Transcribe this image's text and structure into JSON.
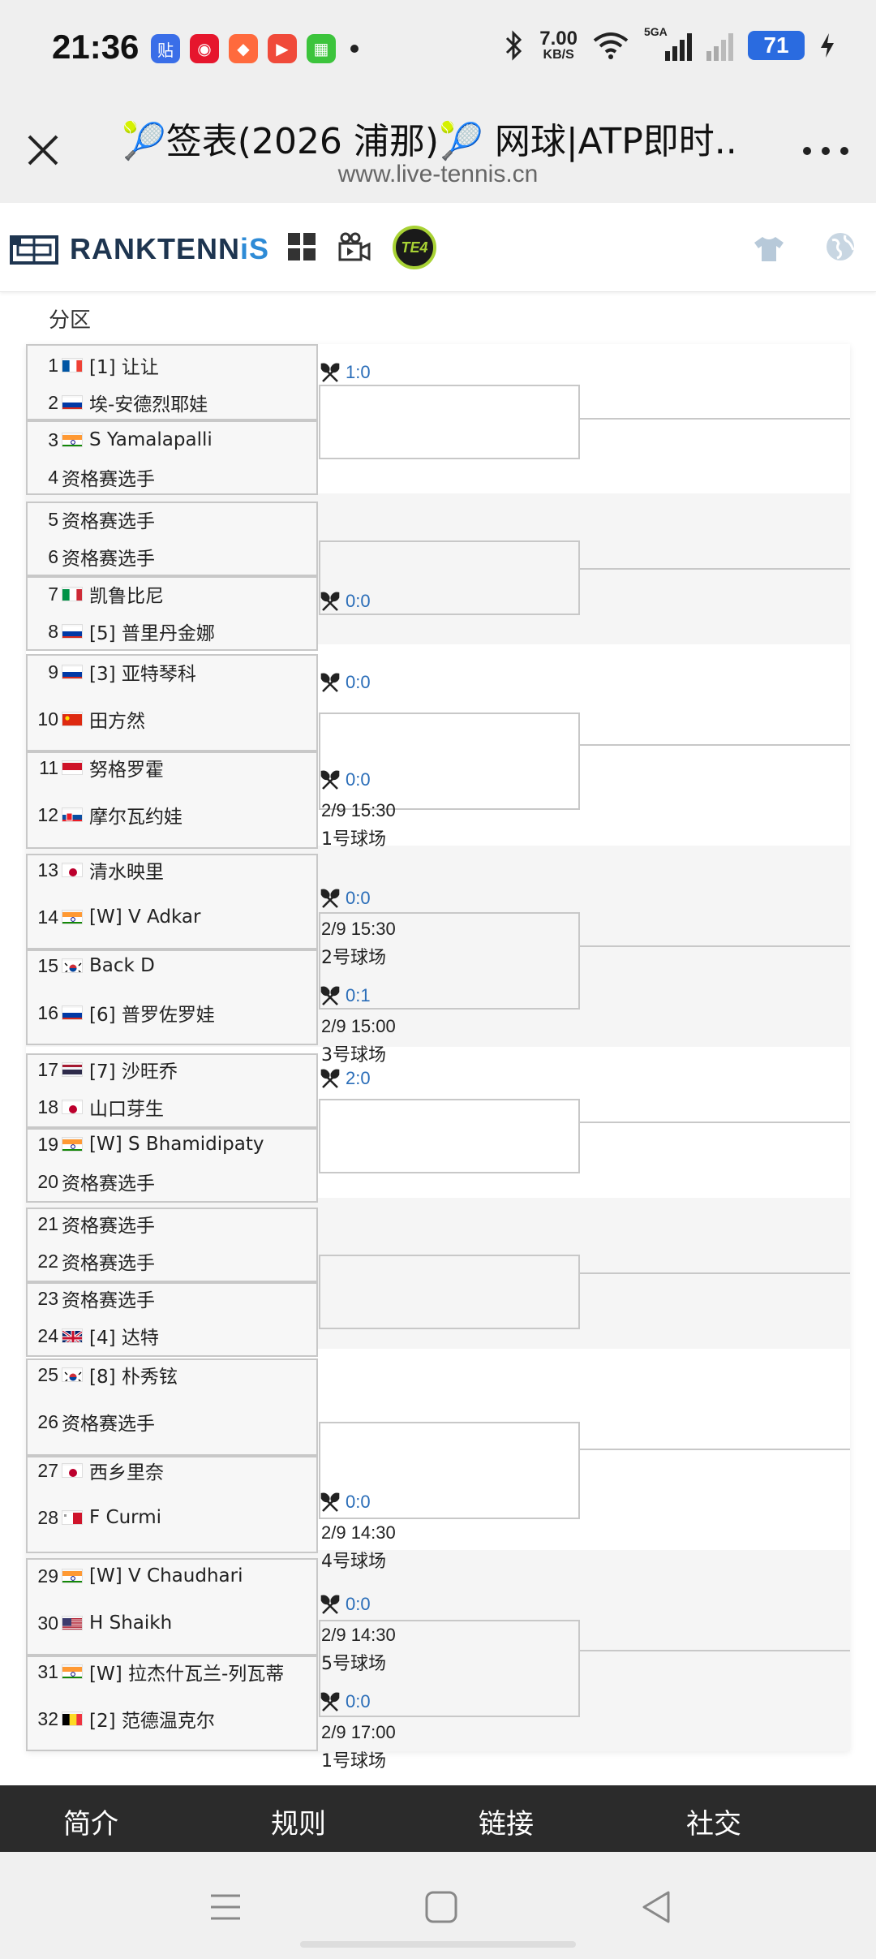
{
  "status_bar": {
    "time": "21:36",
    "net_speed_value": "7.00",
    "net_speed_unit": "KB/S",
    "signal_label": "5GA",
    "battery": "71",
    "app_icons": [
      {
        "name": "tieba-icon",
        "glyph": "贴",
        "color": "#3a6ee8"
      },
      {
        "name": "weibo-icon",
        "glyph": "◉",
        "color": "#e6162d"
      },
      {
        "name": "game-icon",
        "glyph": "◆",
        "color": "#ff6a3d"
      },
      {
        "name": "video-play-icon",
        "glyph": "▶",
        "color": "#f04a3a"
      },
      {
        "name": "app-store-icon",
        "glyph": "▦",
        "color": "#3cc43c"
      }
    ]
  },
  "browser": {
    "title": "🎾签表(2026 浦那)🎾 网球|ATP即时...",
    "url": "www.live-tennis.cn"
  },
  "site_header": {
    "logo_text_main": "RANKTENN",
    "logo_text_accent": "iS",
    "badge": "TE4"
  },
  "section": {
    "title": "分区"
  },
  "players": [
    {
      "seed": "1",
      "flag": "fr",
      "name": "[1] 让让"
    },
    {
      "seed": "2",
      "flag": "ru",
      "name": "埃-安德烈耶娃"
    },
    {
      "seed": "3",
      "flag": "in",
      "name": "S Yamalapalli"
    },
    {
      "seed": "4",
      "flag": "",
      "name": "资格赛选手"
    },
    {
      "seed": "5",
      "flag": "",
      "name": "资格赛选手"
    },
    {
      "seed": "6",
      "flag": "",
      "name": "资格赛选手"
    },
    {
      "seed": "7",
      "flag": "it",
      "name": "凯鲁比尼"
    },
    {
      "seed": "8",
      "flag": "ru",
      "name": "[5] 普里丹金娜"
    },
    {
      "seed": "9",
      "flag": "ru",
      "name": "[3] 亚特琴科"
    },
    {
      "seed": "10",
      "flag": "cn",
      "name": "田方然"
    },
    {
      "seed": "11",
      "flag": "id",
      "name": "努格罗霍"
    },
    {
      "seed": "12",
      "flag": "sk",
      "name": "摩尔瓦约娃"
    },
    {
      "seed": "13",
      "flag": "jp",
      "name": "清水映里"
    },
    {
      "seed": "14",
      "flag": "in",
      "name": "[W] V Adkar"
    },
    {
      "seed": "15",
      "flag": "kr",
      "name": "Back D"
    },
    {
      "seed": "16",
      "flag": "ru",
      "name": "[6] 普罗佐罗娃"
    },
    {
      "seed": "17",
      "flag": "th",
      "name": "[7] 沙旺乔"
    },
    {
      "seed": "18",
      "flag": "jp",
      "name": "山口芽生"
    },
    {
      "seed": "19",
      "flag": "in",
      "name": "[W] S Bhamidipaty"
    },
    {
      "seed": "20",
      "flag": "",
      "name": "资格赛选手"
    },
    {
      "seed": "21",
      "flag": "",
      "name": "资格赛选手"
    },
    {
      "seed": "22",
      "flag": "",
      "name": "资格赛选手"
    },
    {
      "seed": "23",
      "flag": "",
      "name": "资格赛选手"
    },
    {
      "seed": "24",
      "flag": "gb",
      "name": "[4] 达特"
    },
    {
      "seed": "25",
      "flag": "kr",
      "name": "[8] 朴秀铉"
    },
    {
      "seed": "26",
      "flag": "",
      "name": "资格赛选手"
    },
    {
      "seed": "27",
      "flag": "jp",
      "name": "西乡里奈"
    },
    {
      "seed": "28",
      "flag": "mt",
      "name": "F Curmi"
    },
    {
      "seed": "29",
      "flag": "in",
      "name": "[W] V Chaudhari"
    },
    {
      "seed": "30",
      "flag": "us",
      "name": "H Shaikh"
    },
    {
      "seed": "31",
      "flag": "in",
      "name": "[W] 拉杰什瓦兰-列瓦蒂"
    },
    {
      "seed": "32",
      "flag": "be",
      "name": "[2] 范德温克尔"
    }
  ],
  "matches": [
    {
      "score": "1:0",
      "time": "",
      "court": ""
    },
    {
      "score": "0:0",
      "time": "",
      "court": ""
    },
    {
      "score": "0:0",
      "time": "",
      "court": ""
    },
    {
      "score": "0:0",
      "time": "2/9 15:30",
      "court": "1号球场"
    },
    {
      "score": "0:0",
      "time": "2/9 15:30",
      "court": "2号球场"
    },
    {
      "score": "0:1",
      "time": "2/9 15:00",
      "court": "3号球场"
    },
    {
      "score": "2:0",
      "time": "",
      "court": ""
    },
    {
      "score": "0:0",
      "time": "2/9 14:30",
      "court": "4号球场"
    },
    {
      "score": "0:0",
      "time": "2/9 14:30",
      "court": "5号球场"
    },
    {
      "score": "0:0",
      "time": "2/9 17:00",
      "court": "1号球场"
    }
  ],
  "footer": {
    "items": [
      "简介",
      "规则",
      "链接",
      "社交"
    ]
  }
}
